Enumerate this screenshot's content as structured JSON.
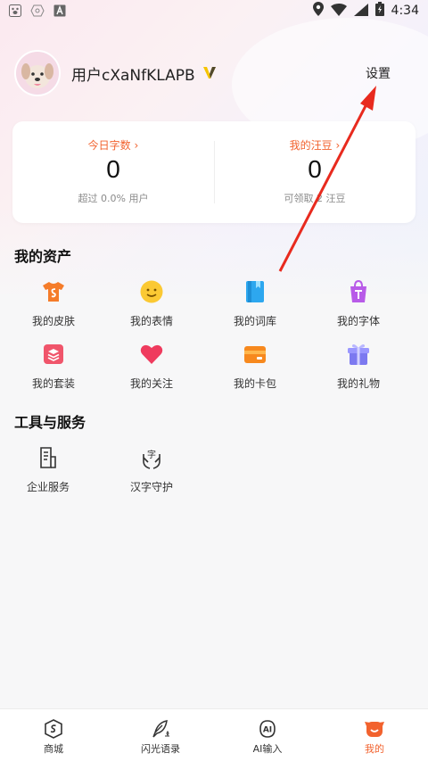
{
  "status_bar": {
    "time": "4:34"
  },
  "header": {
    "username": "用户cXaNfKLAPB",
    "settings_label": "设置"
  },
  "stats": {
    "left": {
      "title": "今日字数",
      "value": "0",
      "sub": "超过 0.0% 用户"
    },
    "right": {
      "title": "我的汪豆",
      "value": "0",
      "sub": "可领取 2 汪豆"
    }
  },
  "assets": {
    "title": "我的资产",
    "items": [
      {
        "label": "我的皮肤",
        "icon": "shirt-icon"
      },
      {
        "label": "我的表情",
        "icon": "smiley-icon"
      },
      {
        "label": "我的词库",
        "icon": "book-icon"
      },
      {
        "label": "我的字体",
        "icon": "font-bag-icon"
      },
      {
        "label": "我的套装",
        "icon": "layers-icon"
      },
      {
        "label": "我的关注",
        "icon": "heart-icon"
      },
      {
        "label": "我的卡包",
        "icon": "card-wallet-icon"
      },
      {
        "label": "我的礼物",
        "icon": "gift-icon"
      }
    ]
  },
  "tools": {
    "title": "工具与服务",
    "items": [
      {
        "label": "企业服务",
        "icon": "document-icon"
      },
      {
        "label": "汉字守护",
        "icon": "hands-character-icon"
      }
    ]
  },
  "bottom_nav": {
    "items": [
      {
        "label": "商城",
        "icon": "shop-icon"
      },
      {
        "label": "闪光语录",
        "icon": "feather-pen-icon"
      },
      {
        "label": "AI输入",
        "icon": "ai-icon"
      },
      {
        "label": "我的",
        "icon": "dog-face-icon"
      }
    ],
    "active_index": 3
  },
  "colors": {
    "accent": "#f2622e",
    "arrow": "#e82a1e"
  }
}
